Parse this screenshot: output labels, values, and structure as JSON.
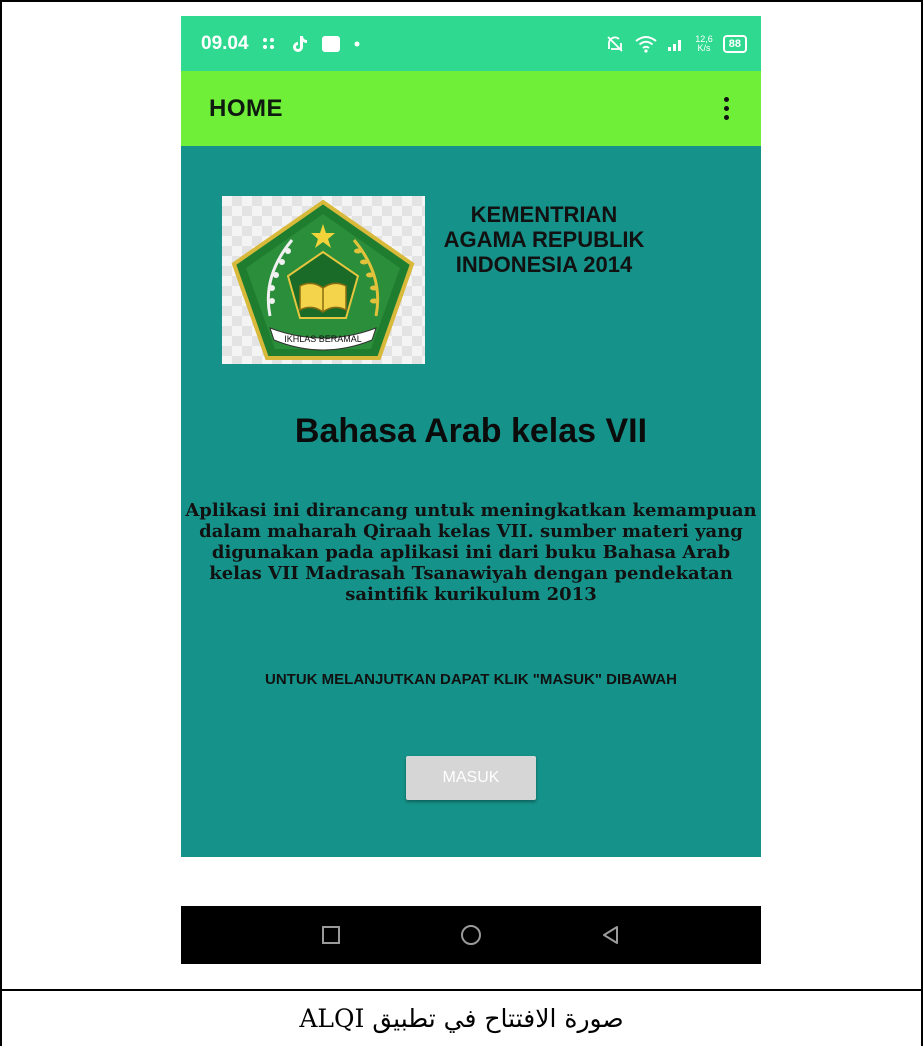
{
  "status_bar": {
    "time": "09.04",
    "left_icons": [
      "grid-icon",
      "tiktok-icon",
      "message-icon",
      "dot-icon"
    ],
    "right_icons": [
      "mute-icon",
      "wifi-icon",
      "signal-icon"
    ],
    "speed_value": "12,6",
    "speed_unit": "K/s",
    "battery": "88"
  },
  "app_bar": {
    "title": "HOME",
    "menu_icon": "more-vert-icon"
  },
  "content": {
    "background_color": "#15938a",
    "logo_icon": "kemenag-emblem-icon",
    "logo_banner": "IKHLAS BERAMAL",
    "ministry_name": "KEMENTRIAN AGAMA REPUBLIK INDONESIA 2014",
    "heading": "Bahasa Arab kelas VII",
    "description": "Aplikasi ini dirancang untuk meningkatkan kemampuan dalam maharah Qiraah kelas VII. sumber materi yang digunakan pada aplikasi ini dari buku Bahasa Arab kelas VII Madrasah Tsanawiyah dengan pendekatan saintifik kurikulum 2013",
    "instruction": "UNTUK MELANJUTKAN DAPAT KLIK \"MASUK\" DIBAWAH",
    "button_label": "MASUK"
  },
  "nav_bar": {
    "items": [
      "recents-square-icon",
      "home-circle-icon",
      "back-triangle-icon"
    ]
  },
  "caption": "صورة الافتتاح في تطبيق ALQI",
  "colors": {
    "status_bar": "#2fd98f",
    "app_bar": "#6fef37",
    "content": "#15938a",
    "button": "#d6d6d6"
  }
}
